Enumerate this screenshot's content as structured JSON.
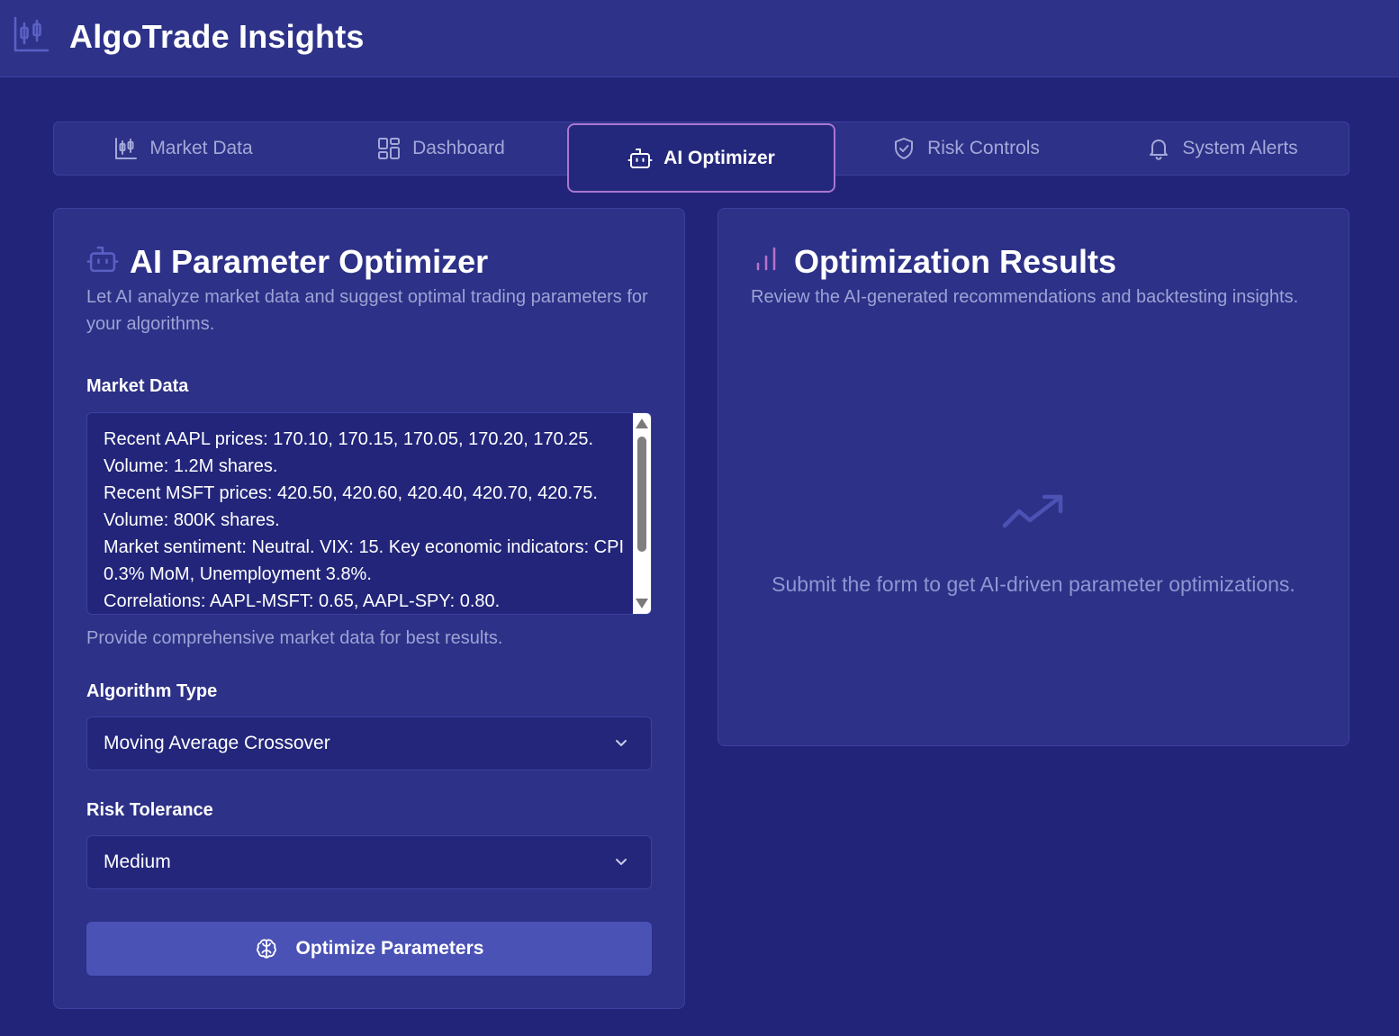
{
  "header": {
    "title": "AlgoTrade Insights",
    "logo_icon": "candlestick-chart-icon"
  },
  "tabs": [
    {
      "label": "Market Data",
      "icon": "candlestick-chart-icon",
      "active": false
    },
    {
      "label": "Dashboard",
      "icon": "dashboard-grid-icon",
      "active": false
    },
    {
      "label": "AI Optimizer",
      "icon": "bot-icon",
      "active": true
    },
    {
      "label": "Risk Controls",
      "icon": "shield-check-icon",
      "active": false
    },
    {
      "label": "System Alerts",
      "icon": "bell-icon",
      "active": false
    }
  ],
  "optimizer": {
    "title": "AI Parameter Optimizer",
    "title_icon": "bot-icon",
    "description": "Let AI analyze market data and suggest optimal trading parameters for your algorithms.",
    "market_data_label": "Market Data",
    "market_data_value": "Recent AAPL prices: 170.10, 170.15, 170.05, 170.20, 170.25.\nVolume: 1.2M shares.\nRecent MSFT prices: 420.50, 420.60, 420.40, 420.70, 420.75.\nVolume: 800K shares.\nMarket sentiment: Neutral. VIX: 15. Key economic indicators: CPI 0.3% MoM, Unemployment 3.8%.\nCorrelations: AAPL-MSFT: 0.65, AAPL-SPY: 0.80.",
    "market_data_helper": "Provide comprehensive market data for best results.",
    "algorithm_label": "Algorithm Type",
    "algorithm_value": "Moving Average Crossover",
    "risk_label": "Risk Tolerance",
    "risk_value": "Medium",
    "submit_label": "Optimize Parameters",
    "submit_icon": "brain-icon"
  },
  "results": {
    "title": "Optimization Results",
    "title_icon": "bar-chart-icon",
    "description": "Review the AI-generated recommendations and backtesting insights.",
    "empty_icon": "trending-up-icon",
    "empty_text": "Submit the form to get AI-driven parameter optimizations."
  },
  "colors": {
    "background": "#222479",
    "surface": "#2d3187",
    "accent": "#a877d0",
    "primary_button": "#4a52b6",
    "muted_text": "#9da3d6"
  }
}
